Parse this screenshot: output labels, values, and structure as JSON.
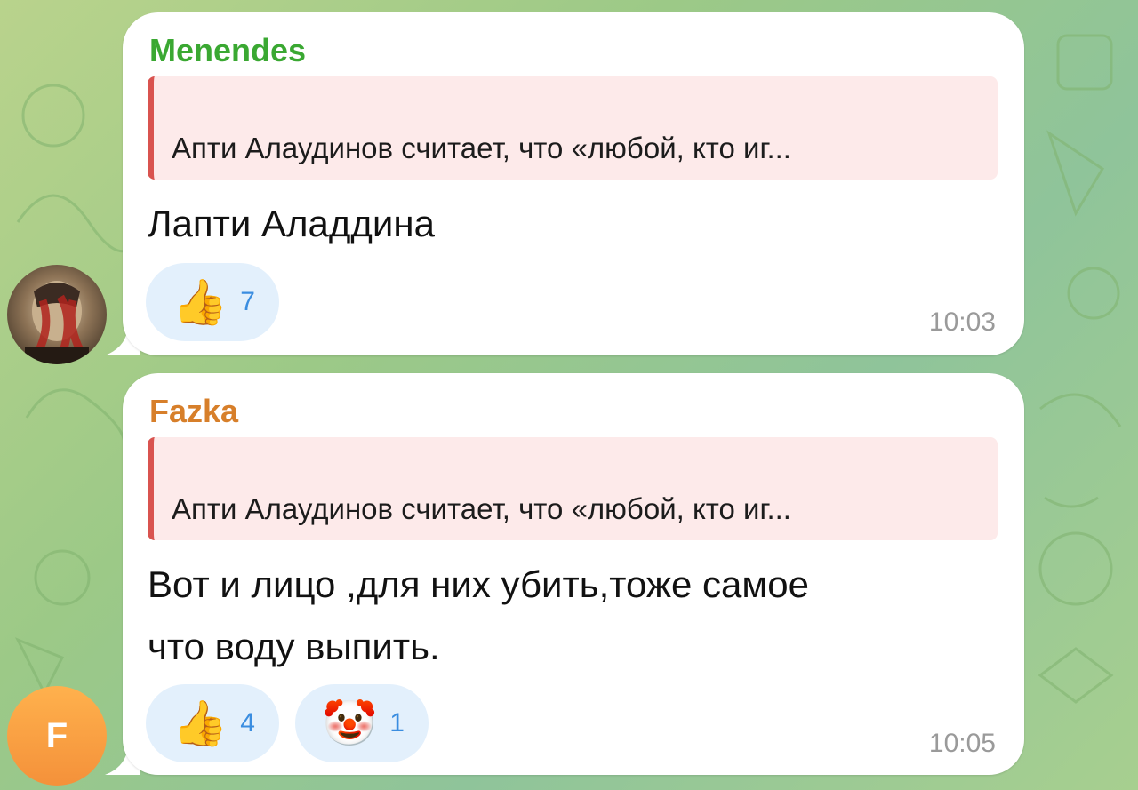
{
  "messages": [
    {
      "sender": "Menendes",
      "sender_color": "#3aa832",
      "reply_preview": "Апти Алаудинов считает, что «любой, кто иг...",
      "text": "Лапти Аладдина",
      "reactions": [
        {
          "emoji": "👍",
          "icon": "thumbs-up-icon",
          "count": "7"
        }
      ],
      "time": "10:03",
      "avatar": "profile-photo"
    },
    {
      "sender": "Fazka",
      "sender_color": "#d77f2a",
      "reply_preview": "Апти Алаудинов считает, что «любой, кто иг...",
      "text_lines": [
        "Вот и лицо ,для них убить,тоже самое",
        "что воду выпить."
      ],
      "reactions": [
        {
          "emoji": "👍",
          "icon": "thumbs-up-icon",
          "count": "4"
        },
        {
          "emoji": "🤡",
          "icon": "clown-face-icon",
          "count": "1"
        }
      ],
      "time": "10:05",
      "avatar_letter": "F"
    }
  ]
}
